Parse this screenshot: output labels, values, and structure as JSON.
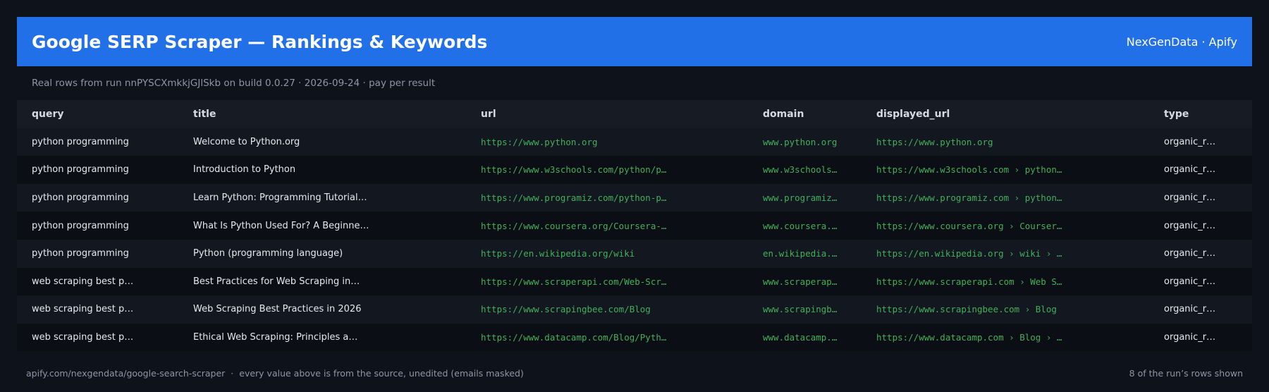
{
  "header": {
    "title": "Google SERP Scraper — Rankings & Keywords",
    "brand": "NexGenData · Apify"
  },
  "subtitle": "Real rows from run nnPYSCXmkkjGJlSkb on build 0.0.27 · 2026-09-24 · pay per result",
  "table": {
    "columns": [
      "query",
      "title",
      "url",
      "domain",
      "displayed_url",
      "type"
    ],
    "rows": [
      [
        "python programming",
        "Welcome to Python.org",
        "https://www.python.org",
        "www.python.org",
        "https://www.python.org",
        "organic_r…"
      ],
      [
        "python programming",
        "Introduction to Python",
        "https://www.w3schools.com/python/p…",
        "www.w3schools…",
        "https://www.w3schools.com › python…",
        "organic_r…"
      ],
      [
        "python programming",
        "Learn Python: Programming Tutorial…",
        "https://www.programiz.com/python-p…",
        "www.programiz…",
        "https://www.programiz.com › python…",
        "organic_r…"
      ],
      [
        "python programming",
        "What Is Python Used For? A Beginne…",
        "https://www.coursera.org/Coursera-…",
        "www.coursera.…",
        "https://www.coursera.org › Courser…",
        "organic_r…"
      ],
      [
        "python programming",
        "Python (programming language)",
        "https://en.wikipedia.org/wiki",
        "en.wikipedia.…",
        "https://en.wikipedia.org › wiki › …",
        "organic_r…"
      ],
      [
        "web scraping best p…",
        "Best Practices for Web Scraping in…",
        "https://www.scraperapi.com/Web-Scr…",
        "www.scraperap…",
        "https://www.scraperapi.com › Web S…",
        "organic_r…"
      ],
      [
        "web scraping best p…",
        "Web Scraping Best Practices in 2026",
        "https://www.scrapingbee.com/Blog",
        "www.scrapingb…",
        "https://www.scrapingbee.com › Blog",
        "organic_r…"
      ],
      [
        "web scraping best p…",
        "Ethical Web Scraping: Principles a…",
        "https://www.datacamp.com/Blog/Pyth…",
        "www.datacamp.…",
        "https://www.datacamp.com › Blog › …",
        "organic_r…"
      ]
    ]
  },
  "footer": {
    "source": "apify.com/nexgendata/google-search-scraper",
    "separator": "·",
    "note": "every value above is from the source, unedited (emails masked)",
    "count": "8 of the run’s rows shown"
  },
  "colors": {
    "background": "#0e121b",
    "header": "#2170e8",
    "url_green": "#43b05b",
    "muted": "#8e95a3"
  }
}
